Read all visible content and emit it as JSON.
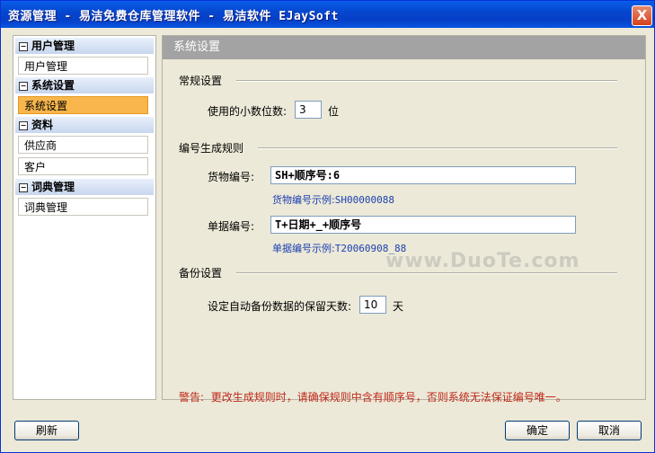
{
  "window": {
    "title": "资源管理 - 易洁免费仓库管理软件 - 易洁软件 EJaySoft",
    "close_glyph": "X"
  },
  "sidebar": {
    "groups": [
      {
        "toggle": "−",
        "label": "用户管理",
        "items": [
          "用户管理"
        ]
      },
      {
        "toggle": "−",
        "label": "系统设置",
        "items": [
          "系统设置"
        ]
      },
      {
        "toggle": "−",
        "label": "资料",
        "items": [
          "供应商",
          "客户"
        ]
      },
      {
        "toggle": "−",
        "label": "词典管理",
        "items": [
          "词典管理"
        ]
      }
    ],
    "selected": "系统设置"
  },
  "panel": {
    "title": "系统设置",
    "general": {
      "heading": "常规设置",
      "decimal_label": "使用的小数位数:",
      "decimal_value": "3",
      "decimal_unit": "位"
    },
    "numbering": {
      "heading": "编号生成规则",
      "goods_label": "货物编号:",
      "goods_value": "SH+顺序号:6",
      "goods_example_label": "货物编号示例:",
      "goods_example_value": "SH00000088",
      "doc_label": "单据编号:",
      "doc_value": "T+日期+_+顺序号",
      "doc_example_label": "单据编号示例:",
      "doc_example_value": "T20060908_88"
    },
    "backup": {
      "heading": "备份设置",
      "days_label": "设定自动备份数据的保留天数:",
      "days_value": "10",
      "days_unit": "天"
    },
    "warning_label": "警告:",
    "warning_text": "更改生成规则时，请确保规则中含有顺序号，否则系统无法保证编号唯一。"
  },
  "buttons": {
    "refresh": "刷新",
    "ok": "确定",
    "cancel": "取消"
  },
  "watermark": "www.DuoTe.com"
}
